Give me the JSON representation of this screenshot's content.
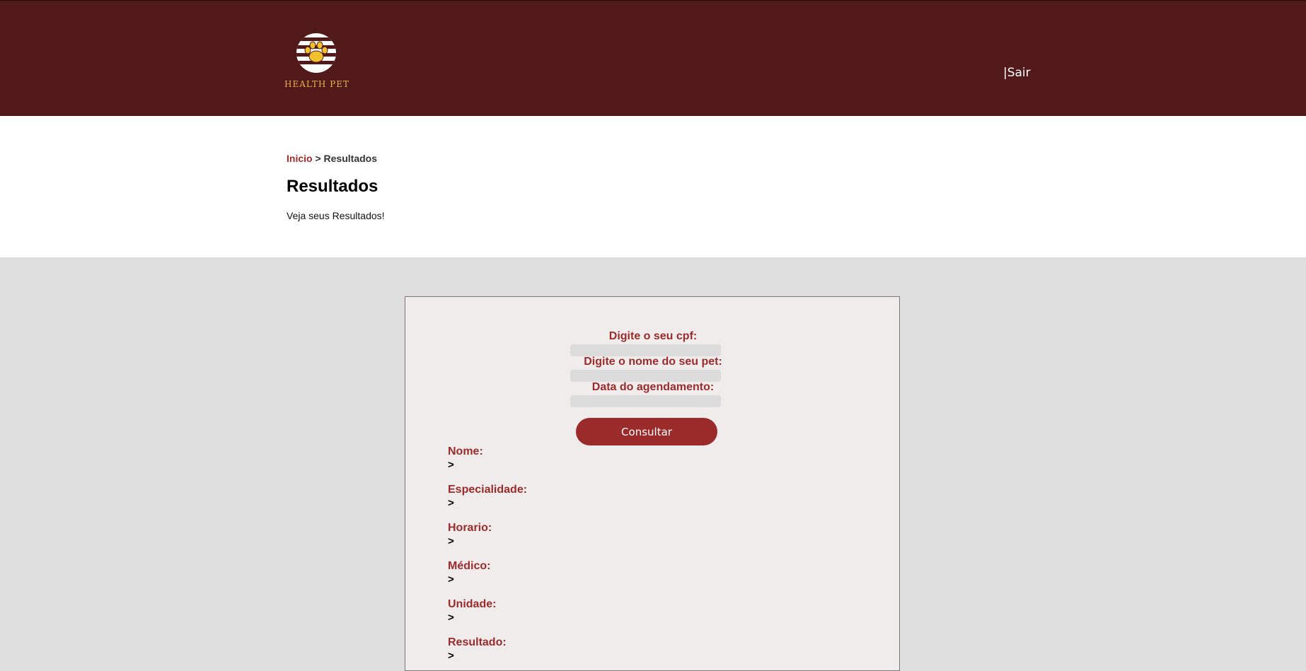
{
  "header": {
    "logo_text": "HEALTH PET",
    "nav_sair": "|Sair"
  },
  "breadcrumb": {
    "home": "Inicio",
    "separator": ">",
    "current": "Resultados"
  },
  "page": {
    "title": "Resultados",
    "subtitle": "Veja seus Resultados!"
  },
  "form": {
    "cpf_label": "Digite o seu cpf:",
    "cpf_value": "",
    "pet_label": "Digite o nome do seu pet:",
    "pet_value": "",
    "date_label": "Data do agendamento:",
    "date_value": "",
    "submit_label": "Consultar"
  },
  "results": [
    {
      "label": "Nome:",
      "value": ">"
    },
    {
      "label": "Especialidade:",
      "value": ">"
    },
    {
      "label": "Horario:",
      "value": ">"
    },
    {
      "label": "Médico:",
      "value": ">"
    },
    {
      "label": "Unidade:",
      "value": ">"
    },
    {
      "label": "Resultado:",
      "value": ">"
    }
  ],
  "colors": {
    "header_bg": "#52191a",
    "accent": "#9b2b2b",
    "logo_gold": "#e7b24a",
    "page_bg": "#dedede",
    "panel_bg": "#f0ecec"
  },
  "icons": {
    "logo": "paw-icon"
  }
}
